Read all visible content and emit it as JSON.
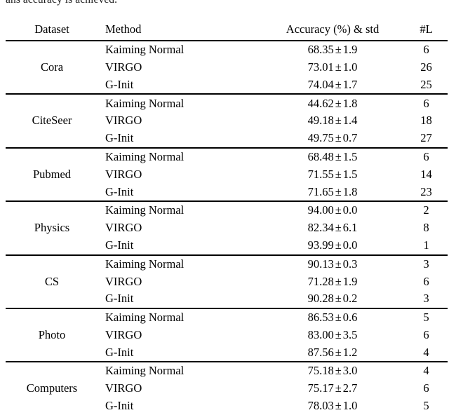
{
  "page": {
    "clipped_paragraph_line": "ans accuracy is achieved."
  },
  "table": {
    "columns": [
      "Dataset",
      "Method",
      "Accuracy (%) & std",
      "#L"
    ],
    "groups": [
      {
        "dataset": "Cora",
        "rows": [
          {
            "method": "Kaiming Normal",
            "accuracy": "68.35",
            "pm": "±",
            "std": "1.9",
            "layers": "6",
            "bold": false
          },
          {
            "method": "VIRGO",
            "accuracy": "73.01",
            "pm": "±",
            "std": "1.0",
            "layers": "26",
            "bold": false
          },
          {
            "method": "G-Init",
            "accuracy": "74.04",
            "pm": "±",
            "std": "1.7",
            "layers": "25",
            "bold": true
          }
        ]
      },
      {
        "dataset": "CiteSeer",
        "rows": [
          {
            "method": "Kaiming Normal",
            "accuracy": "44.62",
            "pm": "±",
            "std": "1.8",
            "layers": "6",
            "bold": false
          },
          {
            "method": "VIRGO",
            "accuracy": "49.18",
            "pm": "±",
            "std": "1.4",
            "layers": "18",
            "bold": false
          },
          {
            "method": "G-Init",
            "accuracy": "49.75",
            "pm": "±",
            "std": "0.7",
            "layers": "27",
            "bold": true
          }
        ]
      },
      {
        "dataset": "Pubmed",
        "rows": [
          {
            "method": "Kaiming Normal",
            "accuracy": "68.48",
            "pm": "±",
            "std": "1.5",
            "layers": "6",
            "bold": false
          },
          {
            "method": "VIRGO",
            "accuracy": "71.55",
            "pm": "±",
            "std": "1.5",
            "layers": "14",
            "bold": false
          },
          {
            "method": "G-Init",
            "accuracy": "71.65",
            "pm": "±",
            "std": "1.8",
            "layers": "23",
            "bold": true
          }
        ]
      },
      {
        "dataset": "Physics",
        "rows": [
          {
            "method": "Kaiming Normal",
            "accuracy": "94.00",
            "pm": "±",
            "std": "0.0",
            "layers": "2",
            "bold": true
          },
          {
            "method": "VIRGO",
            "accuracy": "82.34",
            "pm": "±",
            "std": "6.1",
            "layers": "8",
            "bold": false
          },
          {
            "method": "G-Init",
            "accuracy": "93.99",
            "pm": "±",
            "std": "0.0",
            "layers": "1",
            "bold": false
          }
        ]
      },
      {
        "dataset": "CS",
        "rows": [
          {
            "method": "Kaiming Normal",
            "accuracy": "90.13",
            "pm": "±",
            "std": "0.3",
            "layers": "3",
            "bold": false
          },
          {
            "method": "VIRGO",
            "accuracy": "71.28",
            "pm": "±",
            "std": "1.9",
            "layers": "6",
            "bold": false
          },
          {
            "method": "G-Init",
            "accuracy": "90.28",
            "pm": "±",
            "std": "0.2",
            "layers": "3",
            "bold": true
          }
        ]
      },
      {
        "dataset": "Photo",
        "rows": [
          {
            "method": "Kaiming Normal",
            "accuracy": "86.53",
            "pm": "±",
            "std": "0.6",
            "layers": "5",
            "bold": false
          },
          {
            "method": "VIRGO",
            "accuracy": "83.00",
            "pm": "±",
            "std": "3.5",
            "layers": "6",
            "bold": false
          },
          {
            "method": "G-Init",
            "accuracy": "87.56",
            "pm": "±",
            "std": "1.2",
            "layers": "4",
            "bold": true
          }
        ]
      },
      {
        "dataset": "Computers",
        "rows": [
          {
            "method": "Kaiming Normal",
            "accuracy": "75.18",
            "pm": "±",
            "std": "3.0",
            "layers": "4",
            "bold": false
          },
          {
            "method": "VIRGO",
            "accuracy": "75.17",
            "pm": "±",
            "std": "2.7",
            "layers": "6",
            "bold": false
          },
          {
            "method": "G-Init",
            "accuracy": "78.03",
            "pm": "±",
            "std": "1.0",
            "layers": "5",
            "bold": true
          }
        ]
      }
    ]
  }
}
